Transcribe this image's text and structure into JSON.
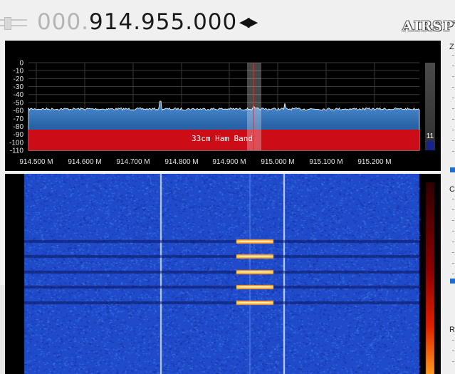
{
  "frequency": {
    "dim_part": "000.",
    "main_part": "914.955.000",
    "arrows": "◀▶"
  },
  "logo": {
    "text": "AIRSPY"
  },
  "spectrum": {
    "y_ticks": [
      "0",
      "-10",
      "-20",
      "-30",
      "-40",
      "-50",
      "-60",
      "-70",
      "-80",
      "-90",
      "-100",
      "-110"
    ],
    "x_ticks": [
      "914.500 M",
      "914.600 M",
      "914.700 M",
      "914.800 M",
      "914.900 M",
      "915.000 M",
      "915.100 M",
      "915.200 M"
    ],
    "band_label": "33cm Ham Band",
    "level_value": "11"
  },
  "right_panel": {
    "zoom_label": "Z",
    "contrast_label": "Co",
    "range_label": "Ra"
  },
  "colors": {
    "band": "#cc0d18",
    "spectrum_fill": "#2d6fb4",
    "waterfall_bg": "#1d45c7",
    "cursor": "#ff2020",
    "accent": "#1c6fd1"
  }
}
